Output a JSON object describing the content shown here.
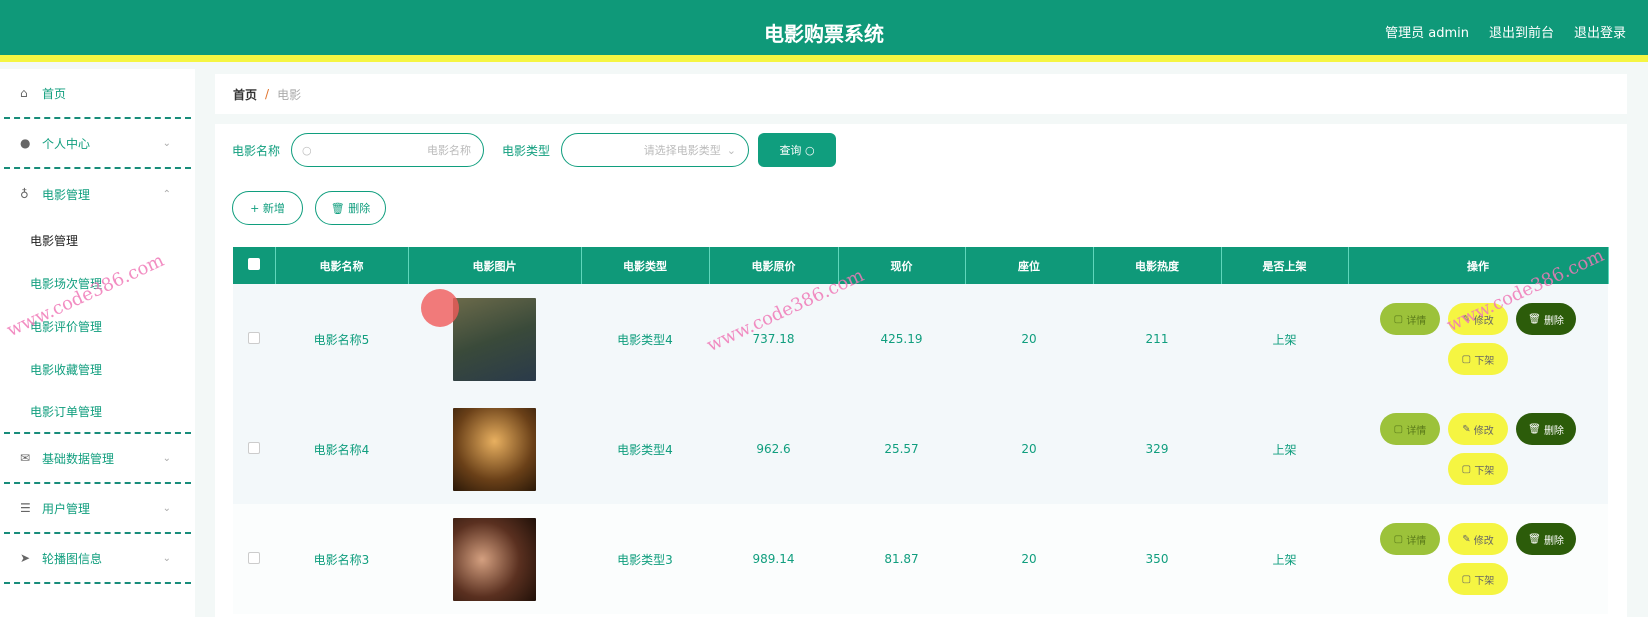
{
  "header": {
    "title": "电影购票系统",
    "user": "管理员 admin",
    "front": "退出到前台",
    "logout": "退出登录"
  },
  "sidebar": {
    "menus": [
      {
        "label": "首页",
        "icon": "⌂"
      },
      {
        "label": "个人中心",
        "icon": "👤"
      },
      {
        "label": "电影管理",
        "icon": "🎙"
      }
    ],
    "subs": [
      "电影管理",
      "电影场次管理",
      "电影评价管理",
      "电影收藏管理",
      "电影订单管理"
    ],
    "menus2": [
      {
        "label": "基础数据管理",
        "icon": "✉"
      },
      {
        "label": "用户管理",
        "icon": "☰"
      },
      {
        "label": "轮播图信息",
        "icon": "➤"
      }
    ]
  },
  "breadcrumb": {
    "home": "首页",
    "current": "电影"
  },
  "search": {
    "name_label": "电影名称",
    "name_placeholder": "电影名称",
    "type_label": "电影类型",
    "type_placeholder": "请选择电影类型",
    "query": "查询",
    "add": "+ 新增",
    "delete": "删除"
  },
  "table": {
    "headers": [
      "电影名称",
      "电影图片",
      "电影类型",
      "电影原价",
      "现价",
      "座位",
      "电影热度",
      "是否上架",
      "操作"
    ],
    "rows": [
      {
        "name": "电影名称5",
        "type": "电影类型4",
        "orig": "737.18",
        "price": "425.19",
        "seats": "20",
        "heat": "211",
        "status": "上架"
      },
      {
        "name": "电影名称4",
        "type": "电影类型4",
        "orig": "962.6",
        "price": "25.57",
        "seats": "20",
        "heat": "329",
        "status": "上架"
      },
      {
        "name": "电影名称3",
        "type": "电影类型3",
        "orig": "989.14",
        "price": "81.87",
        "seats": "20",
        "heat": "350",
        "status": "上架"
      }
    ],
    "actions": {
      "detail": "详情",
      "edit": "修改",
      "delete": "删除",
      "off": "下架"
    }
  },
  "watermark": "www.code386.com",
  "colors": {
    "primary": "#0f9979",
    "accent": "#f5f542"
  }
}
